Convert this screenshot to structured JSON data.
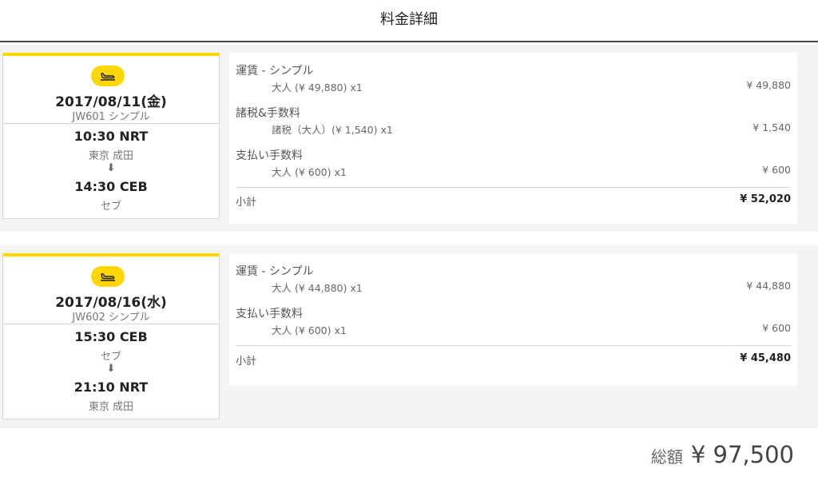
{
  "page": {
    "title": "料金詳細"
  },
  "segments": [
    {
      "flight": {
        "date": "2017/08/11(金)",
        "number": "JW601 シンプル",
        "depart_time": "10:30 NRT",
        "depart_place": "東京 成田",
        "arrow": "⬇",
        "arrive_time": "14:30 CEB",
        "arrive_place": "セブ",
        "icon": "plane-departure-icon"
      },
      "fares": [
        {
          "title": "運賃 - シンプル",
          "line": "大人 (¥ 49,880) x1",
          "amount": "¥ 49,880"
        },
        {
          "title": "諸税&手数料",
          "line": "諸税（大人）(¥ 1,540) x1",
          "amount": "¥ 1,540"
        },
        {
          "title": "支払い手数料",
          "line": "大人 (¥ 600) x1",
          "amount": "¥ 600"
        }
      ],
      "subtotal_label": "小計",
      "subtotal_amount": "¥ 52,020"
    },
    {
      "flight": {
        "date": "2017/08/16(水)",
        "number": "JW602 シンプル",
        "depart_time": "15:30 CEB",
        "depart_place": "セブ",
        "arrow": "⬇",
        "arrive_time": "21:10 NRT",
        "arrive_place": "東京 成田",
        "icon": "plane-departure-icon"
      },
      "fares": [
        {
          "title": "運賃 - シンプル",
          "line": "大人 (¥ 44,880) x1",
          "amount": "¥ 44,880"
        },
        {
          "title": "支払い手数料",
          "line": "大人 (¥ 600) x1",
          "amount": "¥ 600"
        }
      ],
      "subtotal_label": "小計",
      "subtotal_amount": "¥ 45,480"
    }
  ],
  "total": {
    "label": "総額",
    "amount": "¥ 97,500"
  },
  "colors": {
    "accent": "#ffd600",
    "rule": "#444444",
    "panel_bg": "#f4f4f4"
  }
}
